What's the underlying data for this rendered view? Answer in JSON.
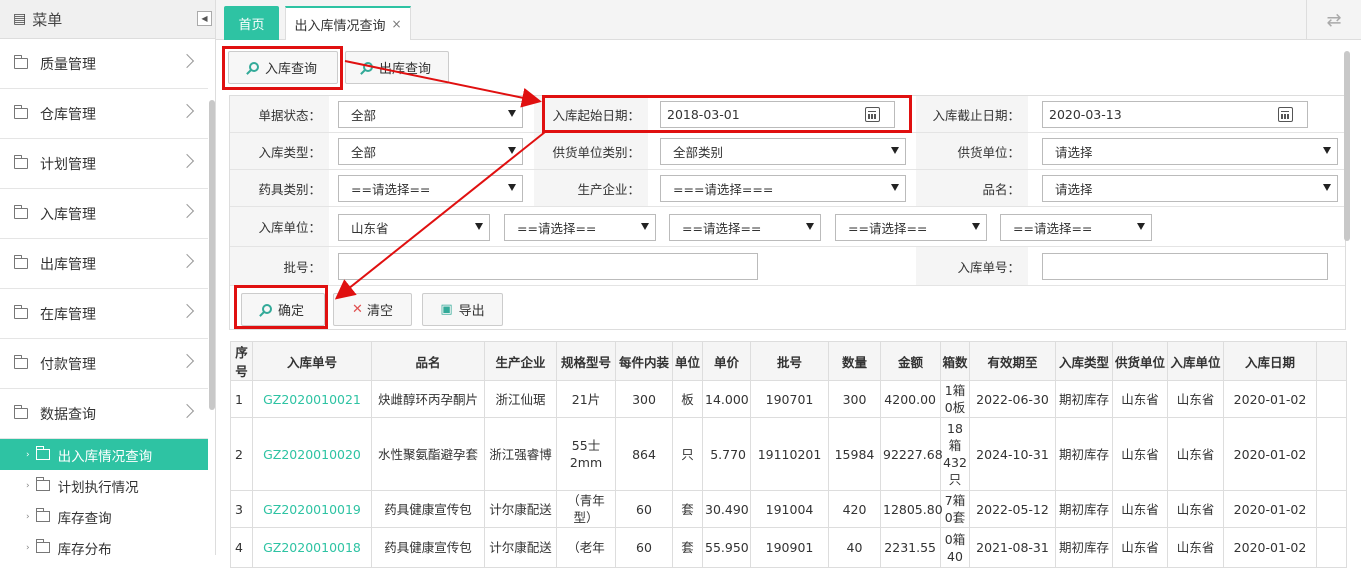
{
  "sidebar": {
    "title": "菜单",
    "items": [
      {
        "label": "质量管理"
      },
      {
        "label": "仓库管理"
      },
      {
        "label": "计划管理"
      },
      {
        "label": "入库管理"
      },
      {
        "label": "出库管理"
      },
      {
        "label": "在库管理"
      },
      {
        "label": "付款管理"
      },
      {
        "label": "数据查询"
      }
    ],
    "subitems": [
      {
        "label": "出入库情况查询"
      },
      {
        "label": "计划执行情况"
      },
      {
        "label": "库存查询"
      },
      {
        "label": "库存分布"
      }
    ]
  },
  "tabs": {
    "home": "首页",
    "current": "出入库情况查询",
    "close": "×"
  },
  "toolbar": {
    "in_query": "入库查询",
    "out_query": "出库查询"
  },
  "form": {
    "status_label": "单据状态：",
    "status_value": "全部",
    "start_label": "入库起始日期：",
    "start_value": "2018-03-01",
    "end_label": "入库截止日期：",
    "end_value": "2020-03-13",
    "type_label": "入库类型：",
    "type_value": "全部",
    "supplier_type_label": "供货单位类别：",
    "supplier_type_value": "全部类别",
    "supplier_label": "供货单位：",
    "supplier_value": "请选择",
    "drug_cat_label": "药具类别：",
    "drug_cat_value": "==请选择==",
    "producer_label": "生产企业：",
    "producer_value": "===请选择===",
    "name_label": "品名：",
    "name_value": "请选择",
    "unit_label": "入库单位：",
    "unit_values": [
      "山东省",
      "==请选择==",
      "==请选择==",
      "==请选择==",
      "==请选择=="
    ],
    "batch_label": "批号：",
    "order_label": "入库单号：",
    "confirm": "确定",
    "clear": "清空",
    "export": "导出"
  },
  "table": {
    "headers": [
      "序号",
      "入库单号",
      "品名",
      "生产企业",
      "规格型号",
      "每件内装",
      "单位",
      "单价",
      "批号",
      "数量",
      "金额",
      "箱数",
      "有效期至",
      "入库类型",
      "供货单位",
      "入库单位",
      "入库日期"
    ],
    "rows": [
      [
        "1",
        "GZ2020010021",
        "炔雌醇环丙孕酮片",
        "浙江仙琚",
        "21片",
        "300",
        "板",
        "14.000",
        "190701",
        "300",
        "4200.00",
        "1箱\n0板",
        "2022-06-30",
        "期初库存",
        "山东省",
        "山东省",
        "2020-01-02"
      ],
      [
        "2",
        "GZ2020010020",
        "水性聚氨酯避孕套",
        "浙江强睿博",
        "55士\n2mm",
        "864",
        "只",
        "5.770",
        "19110201",
        "15984",
        "92227.68",
        "18\n箱\n432\n只",
        "2024-10-31",
        "期初库存",
        "山东省",
        "山东省",
        "2020-01-02"
      ],
      [
        "3",
        "GZ2020010019",
        "药具健康宣传包",
        "计尔康配送",
        "（青年\n型）",
        "60",
        "套",
        "30.490",
        "191004",
        "420",
        "12805.80",
        "7箱\n0套",
        "2022-05-12",
        "期初库存",
        "山东省",
        "山东省",
        "2020-01-02"
      ],
      [
        "4",
        "GZ2020010018",
        "药具健康宣传包",
        "计尔康配送",
        "（老年",
        "60",
        "套",
        "55.950",
        "190901",
        "40",
        "2231.55",
        "0箱\n40",
        "2021-08-31",
        "期初库存",
        "山东省",
        "山东省",
        "2020-01-02"
      ]
    ]
  }
}
